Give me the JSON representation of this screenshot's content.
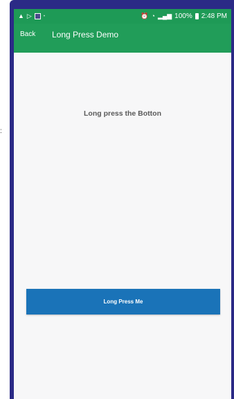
{
  "status_bar": {
    "left_icons": [
      "warning-icon",
      "play-icon",
      "notification-icon",
      "dot-icon"
    ],
    "battery_percent": "100%",
    "time": "2:48 PM"
  },
  "app_bar": {
    "back_label": "Back",
    "title": "Long Press Demo"
  },
  "content": {
    "instruction": "Long press the Botton",
    "button_label": "Long Press Me"
  },
  "colors": {
    "app_bar": "#219d59",
    "button": "#1a73b8",
    "frame": "#2b2a86"
  }
}
